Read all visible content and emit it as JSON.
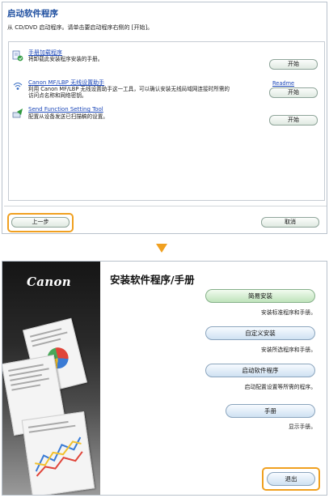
{
  "launch_dialog": {
    "title": "启动软件程序",
    "subtitle": "从 CD/DVD 启动程序。请单击要启动程序右侧的 [开始]。",
    "items": [
      {
        "icon": "manual-install-icon",
        "link": "手册加载程序",
        "desc": [
          "将卸载此安装程序安装的手册。"
        ],
        "button": "开始"
      },
      {
        "icon": "wireless-setup-icon",
        "link": "Canon MF/LBP 无线设置助手",
        "desc": [
          "利用 Canon MF/LBP 无线设置助手这一工具，可以确认安装无线局域网连接时所需的",
          "访问点名称和网络密钥。"
        ],
        "readme": "Readme",
        "button": "开始"
      },
      {
        "icon": "send-function-icon",
        "link": "Send Function Setting Tool",
        "desc": [
          "配置从设备发送已扫描稿的设置。"
        ],
        "button": "开始"
      }
    ],
    "back_button": "上一步",
    "cancel_button": "取消"
  },
  "install_dialog": {
    "logo": "Canon",
    "title": "安装软件程序/手册",
    "options": [
      {
        "button": "简易安装",
        "desc": "安装标准程序和手册。"
      },
      {
        "button": "自定义安装",
        "desc": "安装所选程序和手册。"
      },
      {
        "button": "启动软件程序",
        "desc": "启动配置设置等所需的程序。"
      },
      {
        "button": "手册",
        "desc": "显示手册。"
      }
    ],
    "exit_button": "退出"
  },
  "colors": {
    "highlight": "#f0a020",
    "title_blue": "#1f4fa0",
    "link_blue": "#1a46b8"
  }
}
